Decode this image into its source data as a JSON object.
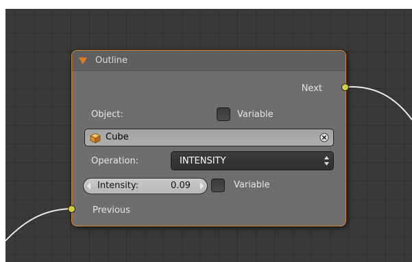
{
  "node": {
    "title": "Outline",
    "outputs": [
      {
        "label": "Next"
      }
    ],
    "inputs": [
      {
        "label": "Previous"
      }
    ],
    "object_label": "Object:",
    "object_variable_label": "Variable",
    "object_variable_checked": false,
    "object_value": "Cube",
    "operation_label": "Operation:",
    "operation_value": "INTENSITY",
    "intensity_label": "Intensity:",
    "intensity_value": "0.09",
    "intensity_variable_label": "Variable",
    "intensity_variable_checked": false
  },
  "colors": {
    "header_accent": "#e07b22",
    "node_border": "#d8892c",
    "socket": "#cfcf3c",
    "canvas": "#393939"
  }
}
